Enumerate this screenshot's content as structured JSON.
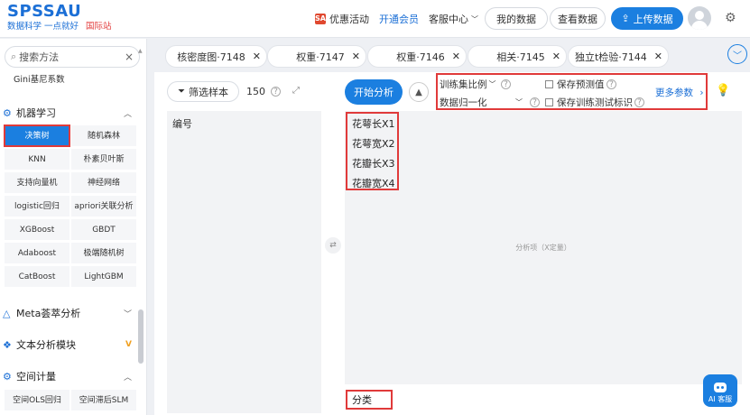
{
  "header": {
    "logo_main": "SPSSAU",
    "logo_sub": "数据科学 一点就好",
    "logo_intl": "国际站",
    "promo": "优惠活动",
    "promo_badge": "SAU",
    "vip": "开通会员",
    "support": "客服中心",
    "my_data": "我的数据",
    "view_data": "查看数据",
    "upload": "上传数据",
    "colors": {
      "brand": "#1b6fd6",
      "primary": "#1b7fe0",
      "intl": "#e23c3c"
    }
  },
  "sidebar": {
    "search_placeholder": "搜索方法",
    "gini": "Gini基尼系数",
    "sections": {
      "ml": "机器学习",
      "meta": "Meta荟萃分析",
      "text": "文本分析模块",
      "spatial": "空间计量"
    },
    "ml_methods": [
      "决策树",
      "随机森林",
      "KNN",
      "朴素贝叶斯",
      "支持向量机",
      "神经网络",
      "logistic回归",
      "apriori关联分析",
      "XGBoost",
      "GBDT",
      "Adaboost",
      "极端随机树",
      "CatBoost",
      "LightGBM"
    ],
    "spatial_methods": [
      "空间OLS回归",
      "空间滞后SLM"
    ]
  },
  "tabs": [
    {
      "label": "核密度图·7148"
    },
    {
      "label": "权重·7147"
    },
    {
      "label": "权重·7146"
    },
    {
      "label": "相关·7145"
    },
    {
      "label": "独立t检验·7144"
    }
  ],
  "main": {
    "filter": "筛选样本",
    "count": "150",
    "start": "开始分析",
    "params": {
      "train_ratio": "训练集比例",
      "normalize": "数据归一化",
      "save_pred": "保存预测值",
      "save_flag": "保存训练测试标识",
      "more": "更多参数"
    },
    "left_header": "编号",
    "variables": [
      "花萼长X1",
      "花萼宽X2",
      "花瓣长X3",
      "花瓣宽X4"
    ],
    "placeholder": "分析项（X定量）",
    "class_var": "分类",
    "ai": "AI 客服"
  }
}
